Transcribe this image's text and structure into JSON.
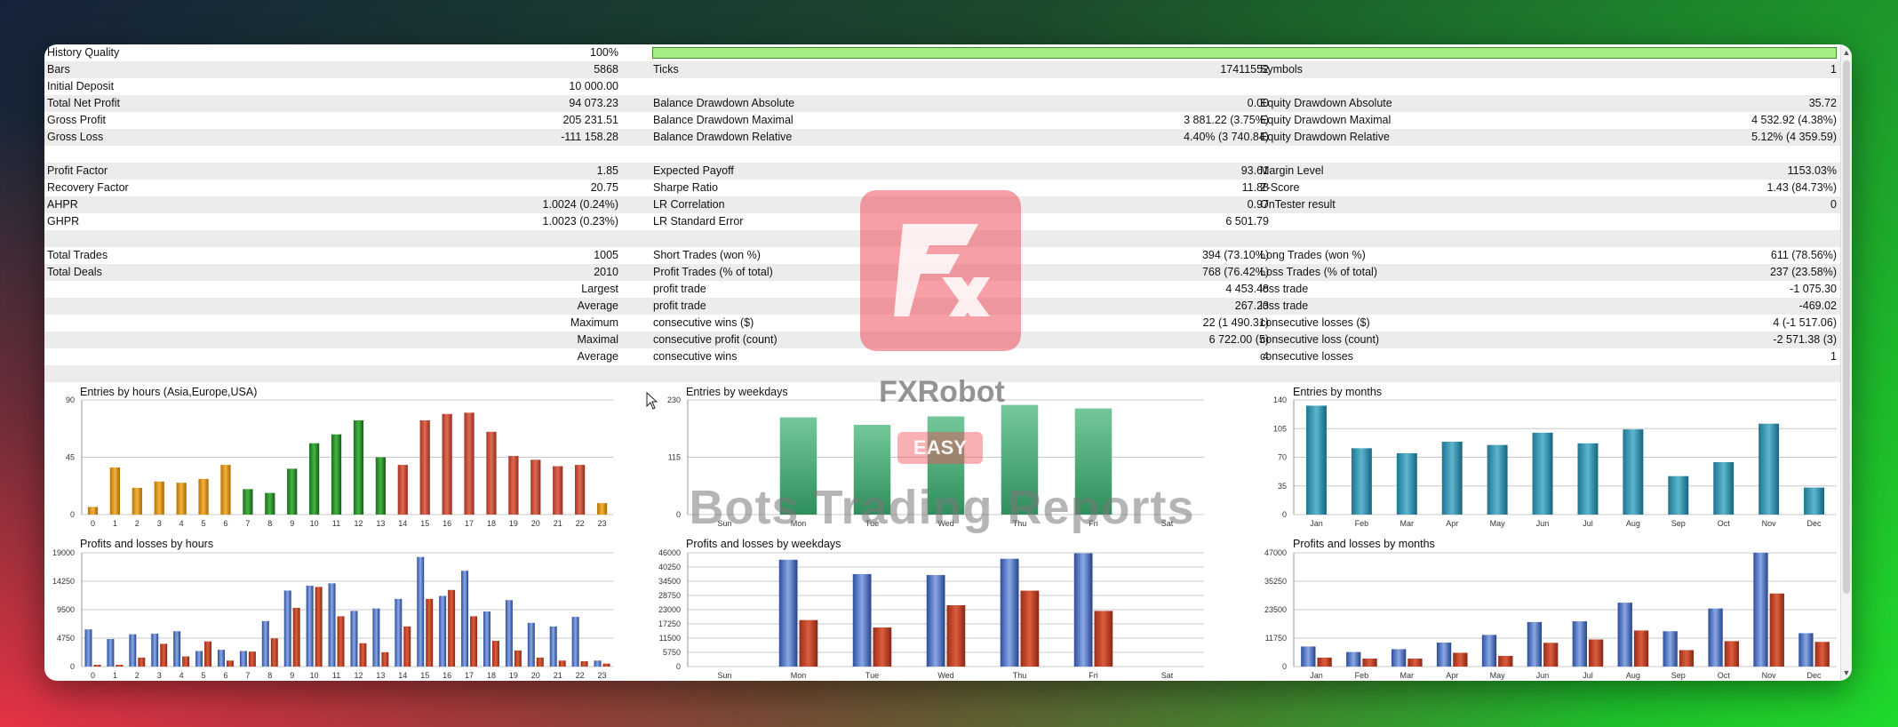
{
  "colors": {
    "accent_green": "#a6ee84",
    "brand_red": "#f1505c"
  },
  "summary": {
    "history_quality": {
      "label": "History Quality",
      "value": "100%",
      "percent": 100
    },
    "bars": {
      "label": "Bars",
      "value": "5868"
    },
    "ticks": {
      "label": "Ticks",
      "value": "17411552"
    },
    "symbols": {
      "label": "Symbols",
      "value": "1"
    },
    "initial_deposit": {
      "label": "Initial Deposit",
      "value": "10 000.00"
    },
    "total_net_profit": {
      "label": "Total Net Profit",
      "value": "94 073.23"
    },
    "balance_dd_abs": {
      "label": "Balance Drawdown Absolute",
      "value": "0.00"
    },
    "equity_dd_abs": {
      "label": "Equity Drawdown Absolute",
      "value": "35.72"
    },
    "gross_profit": {
      "label": "Gross Profit",
      "value": "205 231.51"
    },
    "balance_dd_max": {
      "label": "Balance Drawdown Maximal",
      "value": "3 881.22 (3.75%)"
    },
    "equity_dd_max": {
      "label": "Equity Drawdown Maximal",
      "value": "4 532.92 (4.38%)"
    },
    "gross_loss": {
      "label": "Gross Loss",
      "value": "-111 158.28"
    },
    "balance_dd_rel": {
      "label": "Balance Drawdown Relative",
      "value": "4.40% (3 740.84)"
    },
    "equity_dd_rel": {
      "label": "Equity Drawdown Relative",
      "value": "5.12% (4 359.59)"
    },
    "profit_factor": {
      "label": "Profit Factor",
      "value": "1.85"
    },
    "expected_payoff": {
      "label": "Expected Payoff",
      "value": "93.61"
    },
    "margin_level": {
      "label": "Margin Level",
      "value": "1153.03%"
    },
    "recovery_factor": {
      "label": "Recovery Factor",
      "value": "20.75"
    },
    "sharpe_ratio": {
      "label": "Sharpe Ratio",
      "value": "11.88"
    },
    "z_score": {
      "label": "Z-Score",
      "value": "1.43 (84.73%)"
    },
    "ahpr": {
      "label": "AHPR",
      "value": "1.0024 (0.24%)"
    },
    "lr_correlation": {
      "label": "LR Correlation",
      "value": "0.97"
    },
    "ontester": {
      "label": "OnTester result",
      "value": "0"
    },
    "ghpr": {
      "label": "GHPR",
      "value": "1.0023 (0.23%)"
    },
    "lr_std_error": {
      "label": "LR Standard Error",
      "value": "6 501.79"
    },
    "total_trades": {
      "label": "Total Trades",
      "value": "1005"
    },
    "short_trades": {
      "label": "Short Trades (won %)",
      "value": "394 (73.10%)"
    },
    "long_trades": {
      "label": "Long Trades (won %)",
      "value": "611 (78.56%)"
    },
    "total_deals": {
      "label": "Total Deals",
      "value": "2010"
    },
    "profit_trades": {
      "label": "Profit Trades (% of total)",
      "value": "768 (76.42%)"
    },
    "loss_trades": {
      "label": "Loss Trades (% of total)",
      "value": "237 (23.58%)"
    },
    "largest": {
      "label": "Largest",
      "p_label": "profit trade",
      "p_value": "4 453.48",
      "l_label": "loss trade",
      "l_value": "-1 075.30"
    },
    "average": {
      "label": "Average",
      "p_label": "profit trade",
      "p_value": "267.23",
      "l_label": "loss trade",
      "l_value": "-469.02"
    },
    "maximum": {
      "label": "Maximum",
      "p_label": "consecutive wins ($)",
      "p_value": "22 (1 490.31)",
      "l_label": "consecutive losses ($)",
      "l_value": "4 (-1 517.06)"
    },
    "maximal": {
      "label": "Maximal",
      "p_label": "consecutive profit (count)",
      "p_value": "6 722.00 (5)",
      "l_label": "consecutive loss (count)",
      "l_value": "-2 571.38 (3)"
    },
    "average2": {
      "label": "Average",
      "p_label": "consecutive wins",
      "p_value": "4",
      "l_label": "consecutive losses",
      "l_value": "1"
    }
  },
  "watermark": {
    "name": "FXRobot",
    "badge": "EASY",
    "tagline": "Bots Trading Reports"
  },
  "chart_data": [
    {
      "type": "bar",
      "title": "Entries by hours (Asia,Europe,USA)",
      "categories": [
        "0",
        "1",
        "2",
        "3",
        "4",
        "5",
        "6",
        "7",
        "8",
        "9",
        "10",
        "11",
        "12",
        "13",
        "14",
        "15",
        "16",
        "17",
        "18",
        "19",
        "20",
        "21",
        "22",
        "23"
      ],
      "values": [
        6,
        37,
        21,
        26,
        25,
        28,
        39,
        20,
        17,
        36,
        56,
        63,
        74,
        45,
        39,
        74,
        79,
        80,
        65,
        46,
        43,
        38,
        39,
        9
      ],
      "yticks": [
        "0",
        "45",
        "90"
      ],
      "ylim": [
        0,
        90
      ]
    },
    {
      "type": "bar",
      "title": "Entries by weekdays",
      "categories": [
        "Sun",
        "Mon",
        "Tue",
        "Wed",
        "Thu",
        "Fri",
        "Sat"
      ],
      "values": [
        0,
        195,
        180,
        197,
        220,
        213,
        0
      ],
      "yticks": [
        "0",
        "115",
        "230"
      ],
      "ylim": [
        0,
        230
      ]
    },
    {
      "type": "bar",
      "title": "Entries by months",
      "categories": [
        "Jan",
        "Feb",
        "Mar",
        "Apr",
        "May",
        "Jun",
        "Jul",
        "Aug",
        "Sep",
        "Oct",
        "Nov",
        "Dec"
      ],
      "values": [
        133,
        81,
        75,
        89,
        85,
        100,
        87,
        104,
        47,
        64,
        111,
        33
      ],
      "yticks": [
        "0",
        "35",
        "70",
        "105",
        "140"
      ],
      "ylim": [
        0,
        140
      ]
    },
    {
      "type": "bar",
      "title": "Profits and losses by hours",
      "categories": [
        "0",
        "1",
        "2",
        "3",
        "4",
        "5",
        "6",
        "7",
        "8",
        "9",
        "10",
        "11",
        "12",
        "13",
        "14",
        "15",
        "16",
        "17",
        "18",
        "19",
        "20",
        "21",
        "22",
        "23"
      ],
      "yticks": [
        "0",
        "4750",
        "9500",
        "14250",
        "19000"
      ],
      "ylim": [
        0,
        19000
      ],
      "series": [
        {
          "values": [
            6200,
            4600,
            5400,
            5500,
            5900,
            2600,
            2800,
            2600,
            7600,
            12700,
            13500,
            13900,
            9300,
            9700,
            11300,
            18300,
            11800,
            16000,
            9200,
            11100,
            7300,
            6700,
            8300,
            1000
          ]
        },
        {
          "values": [
            300,
            300,
            1500,
            3800,
            1700,
            4200,
            1000,
            2500,
            4700,
            9800,
            13300,
            8400,
            3900,
            2400,
            6700,
            11300,
            12800,
            8400,
            4300,
            2700,
            1500,
            1000,
            900,
            500
          ]
        }
      ]
    },
    {
      "type": "bar",
      "title": "Profits and losses by weekdays",
      "categories": [
        "Sun",
        "Mon",
        "Tue",
        "Wed",
        "Thu",
        "Fri",
        "Sat"
      ],
      "yticks": [
        "0",
        "5750",
        "11500",
        "17250",
        "23000",
        "28750",
        "34500",
        "40250",
        "46000"
      ],
      "ylim": [
        0,
        46000
      ],
      "series": [
        {
          "values": [
            0,
            43200,
            37400,
            37000,
            43600,
            45800,
            0
          ]
        },
        {
          "values": [
            0,
            18800,
            15800,
            24800,
            30700,
            22500,
            0
          ]
        }
      ]
    },
    {
      "type": "bar",
      "title": "Profits and losses by months",
      "categories": [
        "Jan",
        "Feb",
        "Mar",
        "Apr",
        "May",
        "Jun",
        "Jul",
        "Aug",
        "Sep",
        "Oct",
        "Nov",
        "Dec"
      ],
      "yticks": [
        "0",
        "11750",
        "23500",
        "35250",
        "47000"
      ],
      "ylim": [
        0,
        47000
      ],
      "series": [
        {
          "values": [
            8300,
            6000,
            7200,
            9900,
            13100,
            18400,
            18700,
            26400,
            14600,
            24000,
            47000,
            13800
          ]
        },
        {
          "values": [
            3700,
            3300,
            3300,
            5700,
            4400,
            9800,
            11200,
            14900,
            6800,
            10500,
            30200,
            10200
          ]
        }
      ]
    }
  ]
}
